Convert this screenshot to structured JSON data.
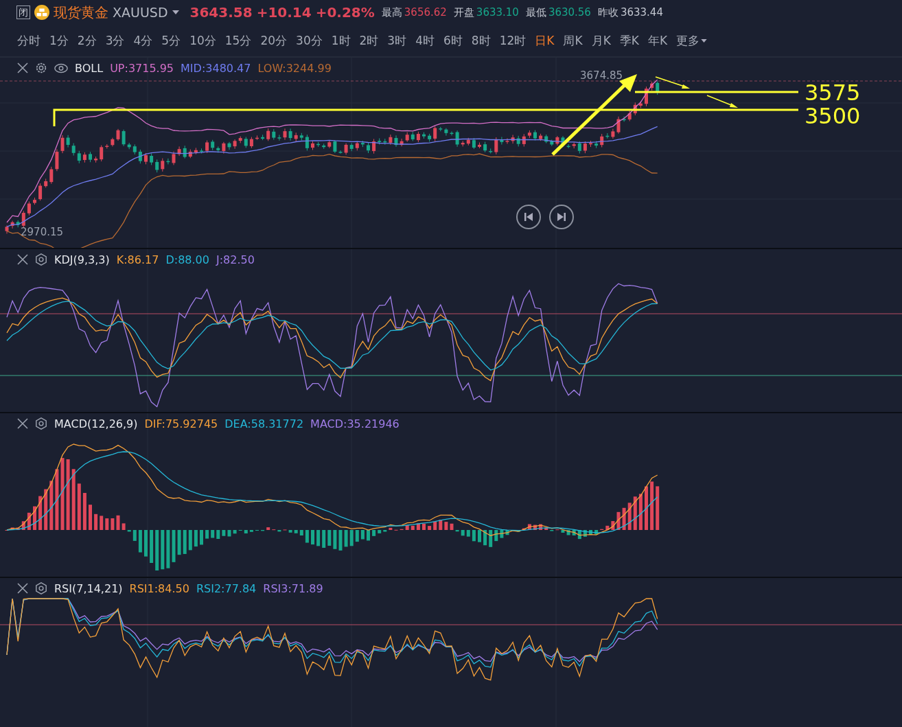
{
  "header": {
    "close_label": "闭",
    "name": "现货黄金",
    "symbol": "XAUUSD",
    "price": "3643.58",
    "change": "+10.14",
    "change_pct": "+0.28%",
    "color": "#e0475a",
    "stats": [
      {
        "label": "最高",
        "value": "3656.62",
        "color": "#e0475a"
      },
      {
        "label": "开盘",
        "value": "3633.10",
        "color": "#17a88b"
      },
      {
        "label": "最低",
        "value": "3630.56",
        "color": "#17a88b"
      },
      {
        "label": "昨收",
        "value": "3633.44",
        "color": "#c3c7d0"
      }
    ]
  },
  "timeframes": [
    {
      "label": "分时",
      "selected": false,
      "kind": "option"
    },
    {
      "label": "1分",
      "selected": false,
      "kind": "option"
    },
    {
      "label": "2分",
      "selected": false,
      "kind": "option"
    },
    {
      "label": "3分",
      "selected": false,
      "kind": "option"
    },
    {
      "label": "4分",
      "selected": false,
      "kind": "option"
    },
    {
      "label": "5分",
      "selected": false,
      "kind": "option"
    },
    {
      "label": "10分",
      "selected": false,
      "kind": "option"
    },
    {
      "label": "15分",
      "selected": false,
      "kind": "option"
    },
    {
      "label": "20分",
      "selected": false,
      "kind": "option"
    },
    {
      "label": "30分",
      "selected": false,
      "kind": "option"
    },
    {
      "label": "1时",
      "selected": false,
      "kind": "option"
    },
    {
      "label": "2时",
      "selected": false,
      "kind": "option"
    },
    {
      "label": "3时",
      "selected": false,
      "kind": "option"
    },
    {
      "label": "4时",
      "selected": false,
      "kind": "option"
    },
    {
      "label": "6时",
      "selected": false,
      "kind": "option"
    },
    {
      "label": "8时",
      "selected": false,
      "kind": "option"
    },
    {
      "label": "12时",
      "selected": false,
      "kind": "option"
    },
    {
      "label": "日K",
      "selected": true,
      "kind": "option"
    },
    {
      "label": "周K",
      "selected": false,
      "kind": "option"
    },
    {
      "label": "月K",
      "selected": false,
      "kind": "option"
    },
    {
      "label": "季K",
      "selected": false,
      "kind": "option"
    },
    {
      "label": "年K",
      "selected": false,
      "kind": "option"
    },
    {
      "label": "更多",
      "selected": false,
      "kind": "menu"
    }
  ],
  "panels": [
    {
      "kind": "boll",
      "title": "BOLL",
      "readings": [
        {
          "text": "UP:3715.95",
          "color": "#d46fc8"
        },
        {
          "text": "MID:3480.47",
          "color": "#6f7cf0"
        },
        {
          "text": "LOW:3244.99",
          "color": "#b86a32"
        }
      ],
      "high_label": "3674.85",
      "low_label": "2970.15",
      "levels": [
        {
          "label": "3575"
        },
        {
          "label": "3500"
        }
      ]
    },
    {
      "kind": "kdj",
      "title": "KDJ(9,3,3)",
      "readings": [
        {
          "text": "K:86.17",
          "color": "#f5a03a"
        },
        {
          "text": "D:88.00",
          "color": "#25b8d8"
        },
        {
          "text": "J:82.50",
          "color": "#a07de8"
        }
      ]
    },
    {
      "kind": "macd",
      "title": "MACD(12,26,9)",
      "readings": [
        {
          "text": "DIF:75.92745",
          "color": "#f5a03a"
        },
        {
          "text": "DEA:58.31772",
          "color": "#25b8d8"
        },
        {
          "text": "MACD:35.21946",
          "color": "#a07de8"
        }
      ]
    },
    {
      "kind": "rsi",
      "title": "RSI(7,14,21)",
      "readings": [
        {
          "text": "RSI1:84.50",
          "color": "#f5a03a"
        },
        {
          "text": "RSI2:77.84",
          "color": "#25b8d8"
        },
        {
          "text": "RSI3:71.89",
          "color": "#a07de8"
        }
      ]
    }
  ]
}
